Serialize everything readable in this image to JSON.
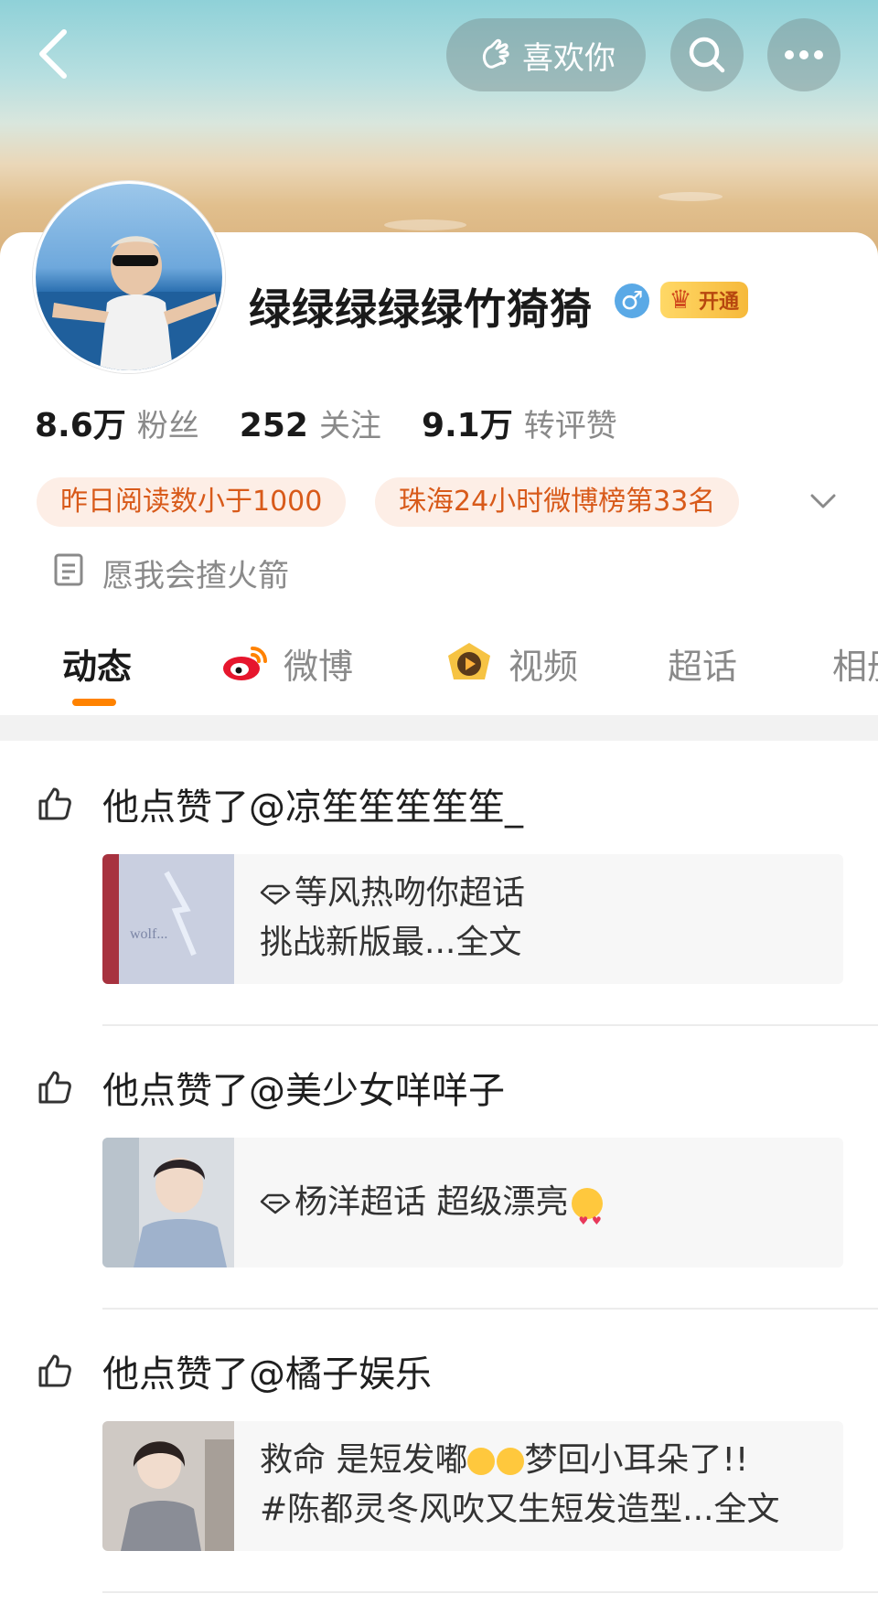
{
  "header": {
    "like_button_label": "喜欢你",
    "back_icon": "chevron-left-icon",
    "search_icon": "search-icon",
    "more_icon": "more-horizontal-icon"
  },
  "profile": {
    "name": "绿绿绿绿绿竹猗猗",
    "gender_symbol": "♂",
    "vip_label": "开通",
    "stats": [
      {
        "value": "8.6万",
        "label": "粉丝"
      },
      {
        "value": "252",
        "label": "关注"
      },
      {
        "value": "9.1万",
        "label": "转评赞"
      }
    ],
    "tags": [
      "昨日阅读数小于1000",
      "珠海24小时微博榜第33名"
    ],
    "bio": "愿我会揸火箭"
  },
  "tabs": [
    {
      "label": "动态",
      "active": true
    },
    {
      "label": "微博",
      "active": false
    },
    {
      "label": "视频",
      "active": false
    },
    {
      "label": "超话",
      "active": false
    },
    {
      "label": "相册",
      "active": false
    }
  ],
  "feed": [
    {
      "action": "他点赞了@凉笙笙笙笙笙_",
      "lines": [
        "等风热吻你超话",
        "挑战新版最...全文"
      ]
    },
    {
      "action": "他点赞了@美少女咩咩子",
      "lines": [
        "杨洋超话  超级漂亮"
      ]
    },
    {
      "action": "他点赞了@橘子娱乐",
      "lines": [
        "救命 是短发嘟",
        "梦回小耳朵了!!",
        "#陈都灵冬风吹又生短发造型...全文"
      ]
    }
  ],
  "colors": {
    "accent": "#ff8200",
    "tag_text": "#d85a1a",
    "tag_bg": "#fdeee6",
    "muted": "#8a8a8a"
  }
}
